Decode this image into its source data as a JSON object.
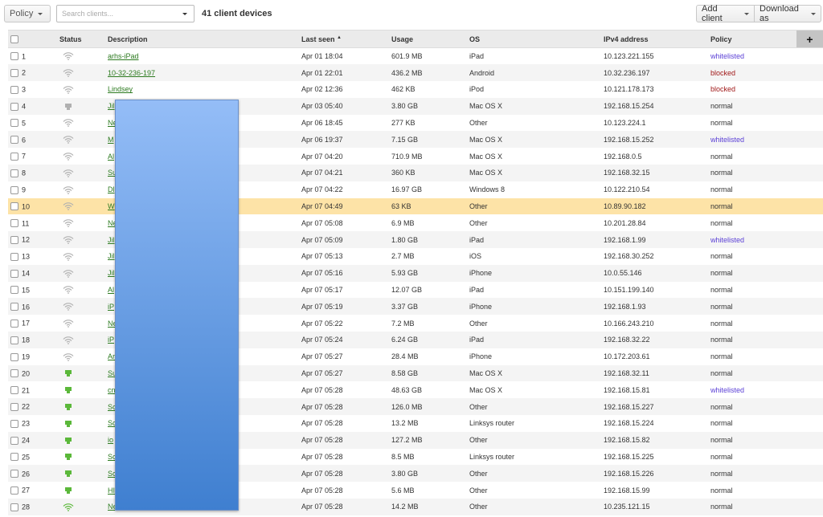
{
  "toolbar": {
    "policy_label": "Policy",
    "search_placeholder": "Search clients...",
    "search_value": "",
    "count_label": "41 client devices",
    "add_client_label": "Add client",
    "download_label": "Download as"
  },
  "table": {
    "headers": {
      "status": "Status",
      "description": "Description",
      "last_seen": "Last seen",
      "last_seen_sort": "▲",
      "usage": "Usage",
      "os": "OS",
      "ipv4": "IPv4 address",
      "policy": "Policy",
      "add_column": "+"
    },
    "rows": [
      {
        "n": "1",
        "status": "wifi-gray",
        "desc": "arhs-iPad",
        "last_seen": "Apr 01 18:04",
        "usage": "601.9 MB",
        "os": "iPad",
        "ip": "10.123.221.155",
        "policy": "whitelisted"
      },
      {
        "n": "2",
        "status": "wifi-gray",
        "desc": "10-32-236-197",
        "last_seen": "Apr 01 22:01",
        "usage": "436.2 MB",
        "os": "Android",
        "ip": "10.32.236.197",
        "policy": "blocked"
      },
      {
        "n": "3",
        "status": "wifi-gray",
        "desc": "Lindsey",
        "last_seen": "Apr 02 12:36",
        "usage": "462 KB",
        "os": "iPod",
        "ip": "10.121.178.173",
        "policy": "blocked"
      },
      {
        "n": "4",
        "status": "wired-gray",
        "desc": "Jil",
        "last_seen": "Apr 03 05:40",
        "usage": "3.80 GB",
        "os": "Mac OS X",
        "ip": "192.168.15.254",
        "policy": "normal"
      },
      {
        "n": "5",
        "status": "wifi-gray",
        "desc": "Ne",
        "last_seen": "Apr 06 18:45",
        "usage": "277 KB",
        "os": "Other",
        "ip": "10.123.224.1",
        "policy": "normal"
      },
      {
        "n": "6",
        "status": "wifi-gray",
        "desc": "M",
        "last_seen": "Apr 06 19:37",
        "usage": "7.15 GB",
        "os": "Mac OS X",
        "ip": "192.168.15.252",
        "policy": "whitelisted"
      },
      {
        "n": "7",
        "status": "wifi-gray",
        "desc": "Al",
        "last_seen": "Apr 07 04:20",
        "usage": "710.9 MB",
        "os": "Mac OS X",
        "ip": "192.168.0.5",
        "policy": "normal"
      },
      {
        "n": "8",
        "status": "wifi-gray",
        "desc": "Su",
        "last_seen": "Apr 07 04:21",
        "usage": "360 KB",
        "os": "Mac OS X",
        "ip": "192.168.32.15",
        "policy": "normal"
      },
      {
        "n": "9",
        "status": "wifi-gray",
        "desc": "Dl",
        "last_seen": "Apr 07 04:22",
        "usage": "16.97 GB",
        "os": "Windows 8",
        "ip": "10.122.210.54",
        "policy": "normal"
      },
      {
        "n": "10",
        "status": "wifi-gray",
        "desc": "W",
        "last_seen": "Apr 07 04:49",
        "usage": "63 KB",
        "os": "Other",
        "ip": "10.89.90.182",
        "policy": "normal",
        "highlight": true
      },
      {
        "n": "11",
        "status": "wifi-gray",
        "desc": "Ne",
        "last_seen": "Apr 07 05:08",
        "usage": "6.9 MB",
        "os": "Other",
        "ip": "10.201.28.84",
        "policy": "normal"
      },
      {
        "n": "12",
        "status": "wifi-gray",
        "desc": "Jil",
        "last_seen": "Apr 07 05:09",
        "usage": "1.80 GB",
        "os": "iPad",
        "ip": "192.168.1.99",
        "policy": "whitelisted"
      },
      {
        "n": "13",
        "status": "wifi-gray",
        "desc": "Jil",
        "last_seen": "Apr 07 05:13",
        "usage": "2.7 MB",
        "os": "iOS",
        "ip": "192.168.30.252",
        "policy": "normal"
      },
      {
        "n": "14",
        "status": "wifi-gray",
        "desc": "Jil",
        "last_seen": "Apr 07 05:16",
        "usage": "5.93 GB",
        "os": "iPhone",
        "ip": "10.0.55.146",
        "policy": "normal"
      },
      {
        "n": "15",
        "status": "wifi-gray",
        "desc": "Al",
        "last_seen": "Apr 07 05:17",
        "usage": "12.07 GB",
        "os": "iPad",
        "ip": "10.151.199.140",
        "policy": "normal"
      },
      {
        "n": "16",
        "status": "wifi-gray",
        "desc": "iP",
        "last_seen": "Apr 07 05:19",
        "usage": "3.37 GB",
        "os": "iPhone",
        "ip": "192.168.1.93",
        "policy": "normal"
      },
      {
        "n": "17",
        "status": "wifi-gray",
        "desc": "Ne",
        "last_seen": "Apr 07 05:22",
        "usage": "7.2 MB",
        "os": "Other",
        "ip": "10.166.243.210",
        "policy": "normal"
      },
      {
        "n": "18",
        "status": "wifi-gray",
        "desc": "iP",
        "last_seen": "Apr 07 05:24",
        "usage": "6.24 GB",
        "os": "iPad",
        "ip": "192.168.32.22",
        "policy": "normal"
      },
      {
        "n": "19",
        "status": "wifi-gray",
        "desc": "Ar",
        "last_seen": "Apr 07 05:27",
        "usage": "28.4 MB",
        "os": "iPhone",
        "ip": "10.172.203.61",
        "policy": "normal"
      },
      {
        "n": "20",
        "status": "wired-green",
        "desc": "Su",
        "last_seen": "Apr 07 05:27",
        "usage": "8.58 GB",
        "os": "Mac OS X",
        "ip": "192.168.32.11",
        "policy": "normal"
      },
      {
        "n": "21",
        "status": "wired-green",
        "desc": "cn",
        "last_seen": "Apr 07 05:28",
        "usage": "48.63 GB",
        "os": "Mac OS X",
        "ip": "192.168.15.81",
        "policy": "whitelisted"
      },
      {
        "n": "22",
        "status": "wired-green",
        "desc": "Sc",
        "last_seen": "Apr 07 05:28",
        "usage": "126.0 MB",
        "os": "Other",
        "ip": "192.168.15.227",
        "policy": "normal"
      },
      {
        "n": "23",
        "status": "wired-green",
        "desc": "Sc",
        "last_seen": "Apr 07 05:28",
        "usage": "13.2 MB",
        "os": "Linksys router",
        "ip": "192.168.15.224",
        "policy": "normal"
      },
      {
        "n": "24",
        "status": "wired-green",
        "desc": "io",
        "last_seen": "Apr 07 05:28",
        "usage": "127.2 MB",
        "os": "Other",
        "ip": "192.168.15.82",
        "policy": "normal"
      },
      {
        "n": "25",
        "status": "wired-green",
        "desc": "Sc",
        "last_seen": "Apr 07 05:28",
        "usage": "8.5 MB",
        "os": "Linksys router",
        "ip": "192.168.15.225",
        "policy": "normal"
      },
      {
        "n": "26",
        "status": "wired-green",
        "desc": "Sc",
        "last_seen": "Apr 07 05:28",
        "usage": "3.80 GB",
        "os": "Other",
        "ip": "192.168.15.226",
        "policy": "normal"
      },
      {
        "n": "27",
        "status": "wired-green",
        "desc": "HI",
        "last_seen": "Apr 07 05:28",
        "usage": "5.6 MB",
        "os": "Other",
        "ip": "192.168.15.99",
        "policy": "normal"
      },
      {
        "n": "28",
        "status": "wifi-green",
        "desc": "Ne",
        "last_seen": "Apr 07 05:28",
        "usage": "14.2 MB",
        "os": "Other",
        "ip": "10.235.121.15",
        "policy": "normal"
      }
    ]
  },
  "colors": {
    "link": "#2c7a1f",
    "whitelisted": "#5a3fd6",
    "blocked": "#a11a1a",
    "highlight_row": "#fde3a7",
    "status_gray": "#b0b0b0",
    "status_green": "#5bb83a",
    "overlay_top": "#94bdf7",
    "overlay_bottom": "#3f7fd0"
  }
}
